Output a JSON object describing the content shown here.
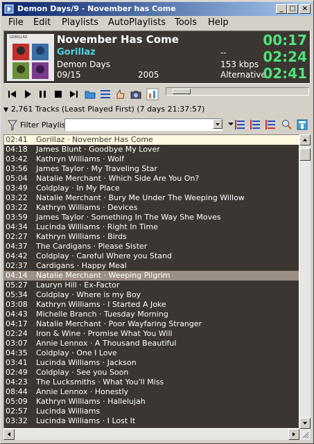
{
  "window": {
    "title": "Demon Days/9 - November has Come"
  },
  "menu": {
    "file": "File",
    "edit": "Edit",
    "playlists": "Playlists",
    "autoplaylists": "AutoPlaylists",
    "tools": "Tools",
    "help": "Help"
  },
  "now_playing": {
    "title": "November Has Come",
    "artist": "Gorillaz",
    "album": "Demon Days",
    "track": "09/15",
    "year": "2005",
    "extra": "--",
    "bitrate": "153 kbps",
    "genre": "Alternative",
    "elapsed": "00:17",
    "remaining": "02:24",
    "total": "02:41",
    "art_label": "GORILLAZ"
  },
  "player": {
    "seek_position": 0.04
  },
  "playlist": {
    "summary": "2,761 Tracks (Least Played First) (7 days 21:37:57)",
    "filter_label": "Filter Playlist",
    "filter_value": "",
    "current_index": 0,
    "selected_index": 14,
    "tracks": [
      {
        "duration": "02:41",
        "text": "Gorillaz · November Has Come"
      },
      {
        "duration": "04:18",
        "text": "James Blunt · Goodbye My Lover"
      },
      {
        "duration": "03:42",
        "text": "Kathryn Williams · Wolf"
      },
      {
        "duration": "03:56",
        "text": "James Taylor · My Traveling Star"
      },
      {
        "duration": "05:04",
        "text": "Natalie Merchant · Which Side Are You On?"
      },
      {
        "duration": "03:49",
        "text": "Coldplay · In My Place"
      },
      {
        "duration": "03:22",
        "text": "Natalie Merchant · Bury Me Under The Weeping Willow"
      },
      {
        "duration": "03:22",
        "text": "Kathryn Williams · Devices"
      },
      {
        "duration": "03:59",
        "text": "James Taylor · Something In The Way She Moves"
      },
      {
        "duration": "04:34",
        "text": "Lucinda Williams · Right In Time"
      },
      {
        "duration": "02:27",
        "text": "Kathryn Williams · Birds"
      },
      {
        "duration": "04:37",
        "text": "The Cardigans · Please Sister"
      },
      {
        "duration": "04:42",
        "text": "Coldplay · Careful Where you Stand"
      },
      {
        "duration": "02:37",
        "text": "Cardigans · Happy Meal"
      },
      {
        "duration": "04:14",
        "text": "Natalie Merchant · Weeping Pilgrim"
      },
      {
        "duration": "05:27",
        "text": "Lauryn Hill · Ex-Factor"
      },
      {
        "duration": "05:34",
        "text": "Coldplay · Where is my Boy"
      },
      {
        "duration": "03:08",
        "text": "Kathryn Williams · I Started A Joke"
      },
      {
        "duration": "04:43",
        "text": "Michelle Branch · Tuesday Morning"
      },
      {
        "duration": "04:17",
        "text": "Natalie Merchant · Poor Wayfaring Stranger"
      },
      {
        "duration": "02:24",
        "text": "Iron & Wine · Promise What You Will"
      },
      {
        "duration": "03:07",
        "text": "Annie Lennox · A Thousand Beautiful"
      },
      {
        "duration": "04:35",
        "text": "Coldplay · One I Love"
      },
      {
        "duration": "03:41",
        "text": "Lucinda Williams · Jackson"
      },
      {
        "duration": "02:49",
        "text": "Coldplay · See you Soon"
      },
      {
        "duration": "04:23",
        "text": "The Lucksmiths · What You'll Miss"
      },
      {
        "duration": "08:44",
        "text": "Annie Lennox · Honestly"
      },
      {
        "duration": "05:09",
        "text": "Kathryn Williams · Hallelujah"
      },
      {
        "duration": "02:57",
        "text": "Lucinda Williams"
      },
      {
        "duration": "03:32",
        "text": "Lucinda Williams · I Lost It"
      }
    ]
  },
  "colors": {
    "playlist_bg": "#3b3631",
    "time_green": "#4ee47c",
    "artist_cyan": "#4ed4e4",
    "selected_row": "#9c8f86",
    "current_row": "#fff8e1"
  }
}
